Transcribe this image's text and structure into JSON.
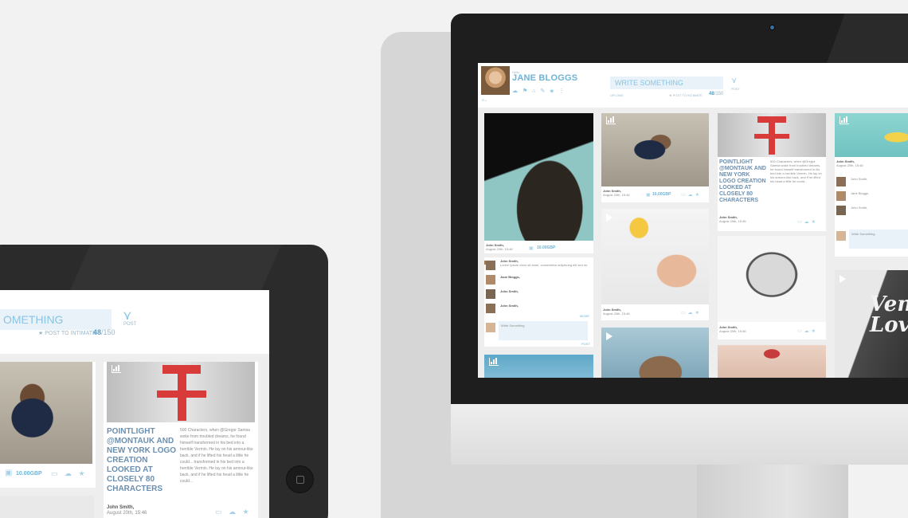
{
  "screen_header": {
    "hello": "Hello,",
    "user_name": "JANE BLOGGS",
    "write_placeholder": "WRITE SOMETHING",
    "upload_label": "UPLOAD",
    "post_to_intimate": "POST TO INTIMATE",
    "char_count": "48",
    "char_max": "/150",
    "post_label": "POST"
  },
  "feed": {
    "post_author": "John Smith,",
    "post_date": "August 20th, 15:46",
    "price": "10.00GBP",
    "headline": "POINTLIGHT @MONTAUK AND NEW YORK LOGO CREATION LOOKED AT CLOSELY 80 CHARACTERS",
    "body_text": "500 Characters, when @Gregor Samsa woke from troubled dreams, he found himself transformed in his bed into a horrible Vermin. He lay on his armour-like back, and if he lifted his head a little he could...",
    "comment_authors": [
      "John Smith,",
      "Jane Bloggs,",
      "John Smith,",
      "John Smith,"
    ],
    "comment_text": "Lorem ipsum dolor sit amet, consectetur adipiscing elit sed do",
    "comment_date": "August 20th, 15:46",
    "more_label": "MORE",
    "write_comment": "Write Something",
    "comment_post": "POST",
    "venice_text": "Vene Love"
  },
  "ipad": {
    "write_placeholder": "OMETHING",
    "post_to_intimate": "POST TO INTIMATE",
    "char_count": "48",
    "char_max": "/150",
    "post_label": "POST",
    "price": "10.00GBP",
    "headline": "POINTLIGHT @MONTAUK AND NEW YORK LOGO CREATION LOOKED AT CLOSELY 80 CHARACTERS",
    "body_text": "500 Characters, when @Gregor Samsa woke from troubled dreams, he found himself transformed in his bed into a horrible Vermin. He lay on his armour-like back, and if he lifted his head a little he could... transformed in his bed into a horrible Vermin. He lay on his armour-like back, and if he lifted his head a little he could...",
    "post_author": "John Smith,",
    "post_date": "August 20th, 15:46"
  },
  "icons": {
    "post": "bird-icon",
    "comment": "comment-icon",
    "cloud": "cloud-icon",
    "star": "star-icon",
    "price_tag": "bag-icon",
    "stats": "bar-chart-icon",
    "play": "play-icon"
  },
  "colors": {
    "accent": "#6fb3d6",
    "accent_light": "#e8f2f8",
    "headline": "#6b8fb0",
    "logo_red": "#d93a3a"
  }
}
